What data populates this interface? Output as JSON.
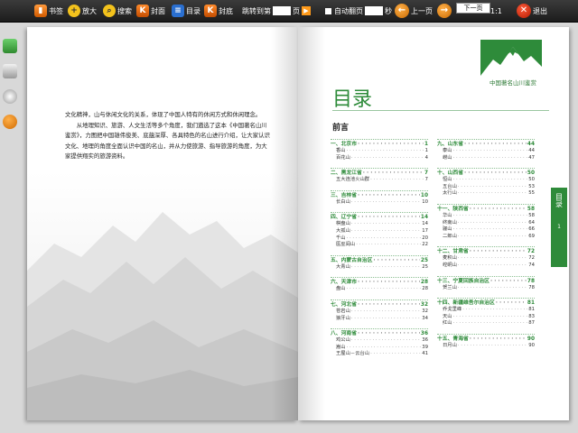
{
  "toolbar": {
    "bookmark": "书签",
    "zoom": "放大",
    "search": "搜索",
    "cover": "封面",
    "contents": "目录",
    "back_cover": "封底",
    "jump_label": "跳转到第",
    "jump_unit": "页",
    "autoflip_label": "自动翻页",
    "autoflip_unit": "秒",
    "prev": "上一页",
    "next_tip": "下一页",
    "page_indicator": "1:1",
    "exit": "退出"
  },
  "side_tools": [
    "cart-icon",
    "image-icon",
    "settings-icon",
    "info-icon"
  ],
  "left_page": {
    "paragraphs": [
      "文化精神，山与休闲文化的关系，体现了中国人特有的休闲方式和休闲理念。",
      "从地理知识、旅游、人文生活等多个角度，我们遴选了这本《中国著名山川鉴赏》，力图把中国雄伟俊美、底蕴深厚、各具特色的名山进行介绍，让大家认识文化、地理的角度全面认识中国的名山，并从力使旅游、指导旅游的角度，为大家提供翔实的旅游资料。"
    ]
  },
  "right_page": {
    "logo_caption": "中国著名山川鉴赏",
    "title": "目录",
    "preface": "前言",
    "side_tab": "目录",
    "side_tab_page": "1",
    "left_column": [
      {
        "prov": "一、北京市",
        "page": "1",
        "items": [
          {
            "name": "香山",
            "page": "1"
          },
          {
            "name": "百花山",
            "page": "4"
          }
        ]
      },
      {
        "prov": "二、黑龙江省",
        "page": "7",
        "items": [
          {
            "name": "五大连池火山群",
            "page": "7"
          }
        ]
      },
      {
        "prov": "三、吉林省",
        "page": "10",
        "items": [
          {
            "name": "长白山",
            "page": "10"
          }
        ]
      },
      {
        "prov": "四、辽宁省",
        "page": "14",
        "items": [
          {
            "name": "棋盘山",
            "page": "14"
          },
          {
            "name": "大孤山",
            "page": "17"
          },
          {
            "name": "千山",
            "page": "20"
          },
          {
            "name": "医巫闾山",
            "page": "22"
          }
        ]
      },
      {
        "prov": "五、内蒙古自治区",
        "page": "25",
        "items": [
          {
            "name": "大青山",
            "page": "25"
          }
        ]
      },
      {
        "prov": "六、天津市",
        "page": "28",
        "items": [
          {
            "name": "盘山",
            "page": "28"
          }
        ]
      },
      {
        "prov": "七、河北省",
        "page": "32",
        "items": [
          {
            "name": "苍岩山",
            "page": "32"
          },
          {
            "name": "狼牙山",
            "page": "34"
          }
        ]
      },
      {
        "prov": "八、河南省",
        "page": "36",
        "items": [
          {
            "name": "鸡公山",
            "page": "36"
          },
          {
            "name": "嵩山",
            "page": "39"
          },
          {
            "name": "王屋山－云台山",
            "page": "41"
          }
        ]
      }
    ],
    "right_column": [
      {
        "prov": "九、山东省",
        "page": "44",
        "items": [
          {
            "name": "泰山",
            "page": "44"
          },
          {
            "name": "崂山",
            "page": "47"
          }
        ]
      },
      {
        "prov": "十、山西省",
        "page": "50",
        "items": [
          {
            "name": "恒山",
            "page": "50"
          },
          {
            "name": "五台山",
            "page": "53"
          },
          {
            "name": "太行山",
            "page": "55"
          }
        ]
      },
      {
        "prov": "十一、陕西省",
        "page": "58",
        "items": [
          {
            "name": "华山",
            "page": "58"
          },
          {
            "name": "终南山",
            "page": "64"
          },
          {
            "name": "骊山",
            "page": "66"
          },
          {
            "name": "二郎山",
            "page": "69"
          }
        ]
      },
      {
        "prov": "十二、甘肃省",
        "page": "72",
        "items": [
          {
            "name": "麦积山",
            "page": "72"
          },
          {
            "name": "崆峒山",
            "page": "74"
          }
        ]
      },
      {
        "prov": "十三、宁夏回族自治区",
        "page": "78",
        "items": [
          {
            "name": "贺兰山",
            "page": "78"
          }
        ]
      },
      {
        "prov": "十四、新疆维吾尔自治区",
        "page": "81",
        "items": [
          {
            "name": "乔戈里峰",
            "page": "81"
          },
          {
            "name": "天山",
            "page": "83"
          },
          {
            "name": "红山",
            "page": "87"
          }
        ]
      },
      {
        "prov": "十五、青海省",
        "page": "90",
        "items": [
          {
            "name": "日月山",
            "page": "90"
          }
        ]
      }
    ]
  }
}
